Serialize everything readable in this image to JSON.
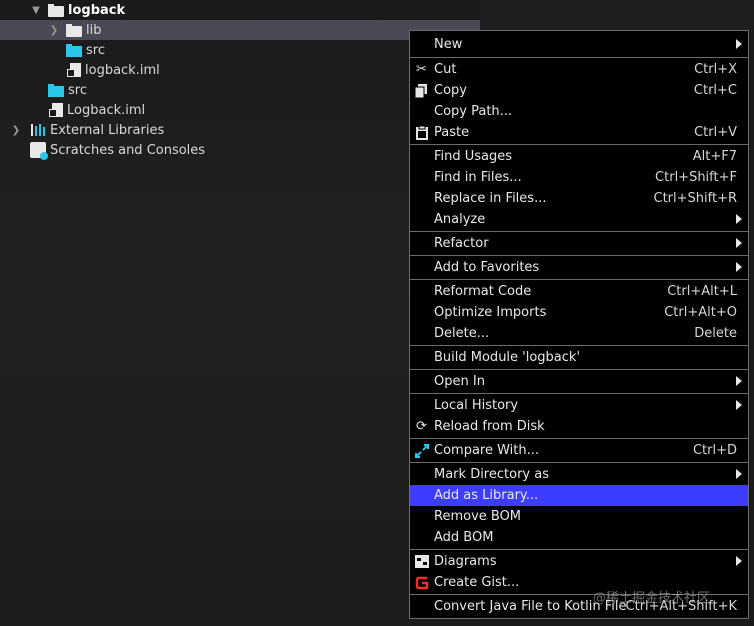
{
  "project_tree": [
    {
      "label": "logback",
      "icon": "folder-icon",
      "expanded": true,
      "bold": true
    },
    {
      "label": "lib",
      "icon": "folder-icon",
      "expanded": false,
      "selected": true
    },
    {
      "label": "src",
      "icon": "source-folder-icon"
    },
    {
      "label": "logback.iml",
      "icon": "module-file-icon"
    },
    {
      "label": "src",
      "icon": "source-folder-icon"
    },
    {
      "label": "Logback.iml",
      "icon": "module-file-icon"
    },
    {
      "label": "External Libraries",
      "icon": "libraries-icon",
      "expanded": false
    },
    {
      "label": "Scratches and Consoles",
      "icon": "scratches-icon"
    }
  ],
  "context_menu": {
    "items": [
      {
        "label": "New",
        "submenu": true
      },
      {
        "label": "Cut",
        "shortcut": "Ctrl+X",
        "icon": "scissors-icon"
      },
      {
        "label": "Copy",
        "shortcut": "Ctrl+C",
        "icon": "copy-icon"
      },
      {
        "label": "Copy Path...",
        "shortcut": ""
      },
      {
        "label": "Paste",
        "shortcut": "Ctrl+V",
        "icon": "clipboard-icon"
      },
      {
        "label": "Find Usages",
        "shortcut": "Alt+F7"
      },
      {
        "label": "Find in Files...",
        "shortcut": "Ctrl+Shift+F"
      },
      {
        "label": "Replace in Files...",
        "shortcut": "Ctrl+Shift+R"
      },
      {
        "label": "Analyze",
        "submenu": true
      },
      {
        "label": "Refactor",
        "submenu": true
      },
      {
        "label": "Add to Favorites",
        "submenu": true
      },
      {
        "label": "Reformat Code",
        "shortcut": "Ctrl+Alt+L"
      },
      {
        "label": "Optimize Imports",
        "shortcut": "Ctrl+Alt+O"
      },
      {
        "label": "Delete...",
        "shortcut": "Delete"
      },
      {
        "label": "Build Module 'logback'",
        "shortcut": ""
      },
      {
        "label": "Open In",
        "submenu": true
      },
      {
        "label": "Local History",
        "submenu": true
      },
      {
        "label": "Reload from Disk",
        "icon": "reload-icon"
      },
      {
        "label": "Compare With...",
        "shortcut": "Ctrl+D",
        "icon": "compare-icon"
      },
      {
        "label": "Mark Directory as",
        "submenu": true
      },
      {
        "label": "Add as Library...",
        "highlighted": true
      },
      {
        "label": "Remove BOM"
      },
      {
        "label": "Add BOM"
      },
      {
        "label": "Diagrams",
        "submenu": true,
        "icon": "diagram-icon"
      },
      {
        "label": "Create Gist...",
        "icon": "gist-icon"
      },
      {
        "label": "Convert Java File to Kotlin File",
        "shortcut": "Ctrl+Alt+Shift+K"
      }
    ]
  },
  "watermark": "@稀土掘金技术社区",
  "colors": {
    "menu_background": "#000000",
    "menu_highlight": "#3d3dff",
    "selection": "#4a4a56",
    "source_folder": "#2bc7e8",
    "gist_red": "#e8322b"
  }
}
